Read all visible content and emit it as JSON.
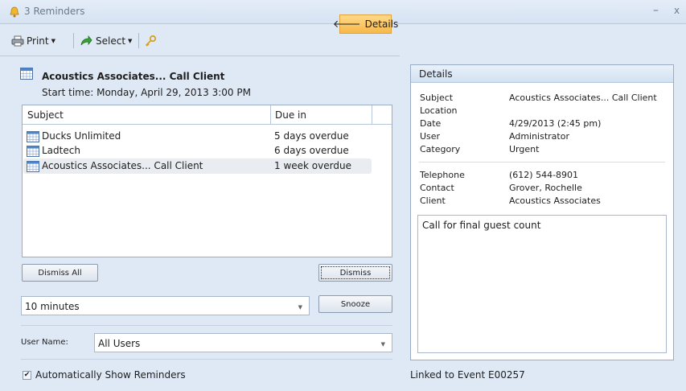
{
  "window": {
    "title": "3 Reminders",
    "minimize": "–",
    "close": "x"
  },
  "toolbar": {
    "print_label": "Print",
    "select_label": "Select",
    "details_label": "Details"
  },
  "reminder": {
    "title": "Acoustics Associates... Call Client",
    "start_time": "Start time: Monday, April 29, 2013 3:00 PM"
  },
  "grid": {
    "columns": [
      "Subject",
      "Due in"
    ],
    "rows": [
      {
        "subject": "Ducks Unlimited",
        "due": "5 days overdue"
      },
      {
        "subject": "Ladtech",
        "due": "6 days overdue"
      },
      {
        "subject": "Acoustics Associates... Call Client",
        "due": "1 week overdue"
      }
    ]
  },
  "buttons": {
    "dismiss_all": "Dismiss All",
    "dismiss": "Dismiss",
    "snooze": "Snooze"
  },
  "snooze": {
    "value": "10 minutes"
  },
  "user": {
    "label": "User Name:",
    "value": "All Users"
  },
  "auto_show": {
    "label": "Automatically Show Reminders",
    "checked": true
  },
  "details": {
    "header": "Details",
    "fields": [
      {
        "key": "Subject",
        "value": "Acoustics Associates... Call Client"
      },
      {
        "key": "Location",
        "value": ""
      },
      {
        "key": "Date",
        "value": "4/29/2013 (2:45 pm)"
      },
      {
        "key": "User",
        "value": "Administrator"
      },
      {
        "key": "Category",
        "value": "Urgent"
      }
    ],
    "contact_fields": [
      {
        "key": "Telephone",
        "value": "(612) 544-8901"
      },
      {
        "key": "Contact",
        "value": "Grover, Rochelle"
      },
      {
        "key": "Client",
        "value": "Acoustics Associates"
      }
    ],
    "notes": "Call for final guest count"
  },
  "linked": "Linked to Event E00257",
  "icons": [
    "bell-icon",
    "printer-icon",
    "select-arrow-icon",
    "key-icon",
    "back-arrow-icon",
    "calendar-icon",
    "checkbox-icon"
  ]
}
